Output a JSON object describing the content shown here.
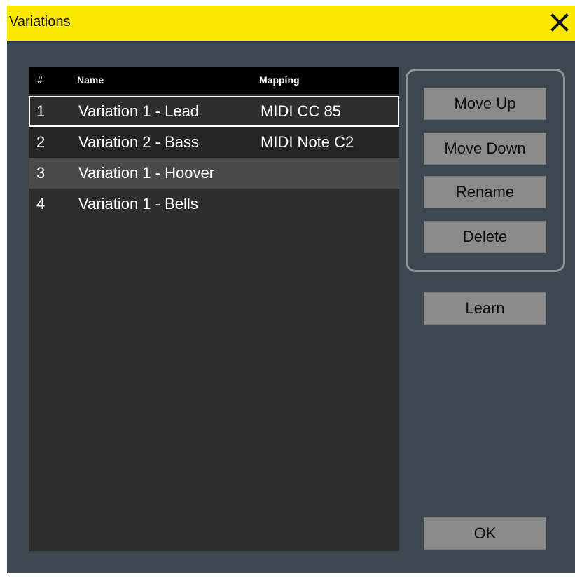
{
  "window": {
    "title": "Variations"
  },
  "table": {
    "headers": {
      "num": "#",
      "name": "Name",
      "mapping": "Mapping"
    },
    "rows": [
      {
        "num": "1",
        "name": "Variation 1 - Lead",
        "mapping": "MIDI CC 85",
        "state": "selected"
      },
      {
        "num": "2",
        "name": "Variation 2 - Bass",
        "mapping": "MIDI Note C2",
        "state": "normal"
      },
      {
        "num": "3",
        "name": "Variation 1 - Hoover",
        "mapping": "",
        "state": "highlighted"
      },
      {
        "num": "4",
        "name": "Variation 1 - Bells",
        "mapping": "",
        "state": "normal"
      }
    ]
  },
  "buttons": {
    "move_up": "Move Up",
    "move_down": "Move Down",
    "rename": "Rename",
    "delete": "Delete",
    "learn": "Learn",
    "ok": "OK"
  },
  "icons": {
    "close": "close-icon"
  },
  "colors": {
    "titlebar": "#fae800",
    "dialog_bg": "#3d4750",
    "table_bg": "#2e2e2e",
    "header_bg": "#000000",
    "button_bg": "#8a8a8a",
    "highlight_row": "#4a4a4a"
  }
}
